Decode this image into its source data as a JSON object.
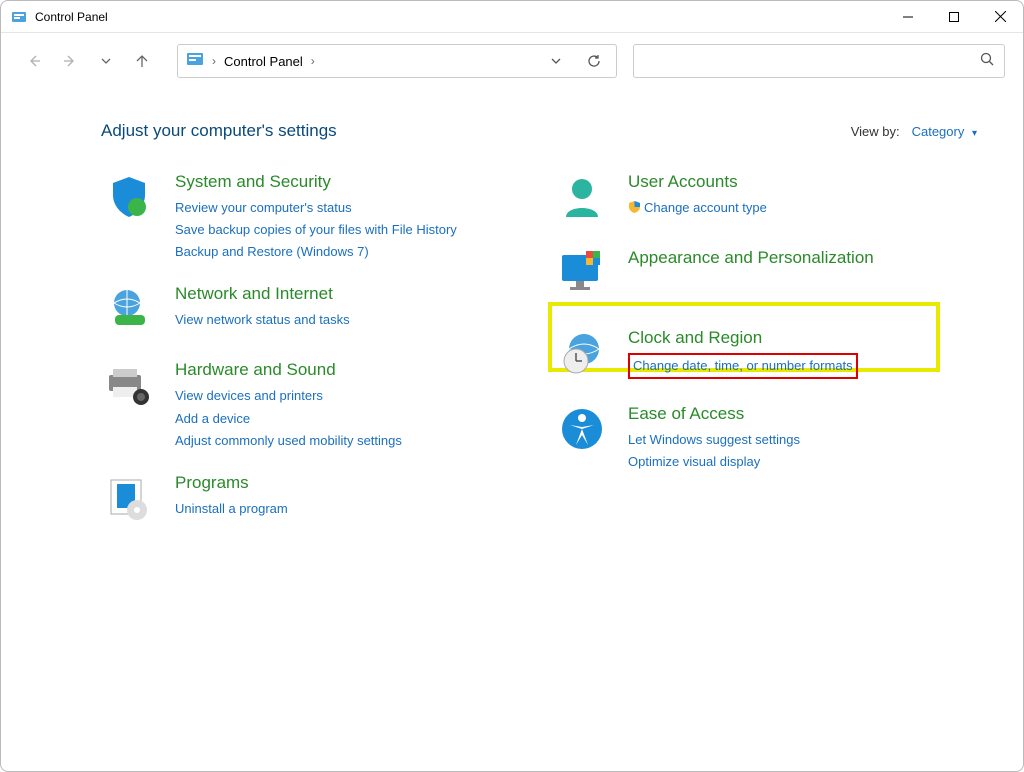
{
  "window": {
    "title": "Control Panel"
  },
  "breadcrumb": {
    "item": "Control Panel"
  },
  "header": {
    "heading": "Adjust your computer's settings",
    "view_by_label": "View by:",
    "view_by_value": "Category"
  },
  "categories": {
    "left": [
      {
        "title": "System and Security",
        "links": [
          "Review your computer's status",
          "Save backup copies of your files with File History",
          "Backup and Restore (Windows 7)"
        ]
      },
      {
        "title": "Network and Internet",
        "links": [
          "View network status and tasks"
        ]
      },
      {
        "title": "Hardware and Sound",
        "links": [
          "View devices and printers",
          "Add a device",
          "Adjust commonly used mobility settings"
        ]
      },
      {
        "title": "Programs",
        "links": [
          "Uninstall a program"
        ]
      }
    ],
    "right": [
      {
        "title": "User Accounts",
        "links": [
          "Change account type"
        ],
        "shield": true
      },
      {
        "title": "Appearance and Personalization",
        "links": []
      },
      {
        "title": "Clock and Region",
        "links": [
          "Change date, time, or number formats"
        ],
        "highlight": true
      },
      {
        "title": "Ease of Access",
        "links": [
          "Let Windows suggest settings",
          "Optimize visual display"
        ]
      }
    ]
  }
}
